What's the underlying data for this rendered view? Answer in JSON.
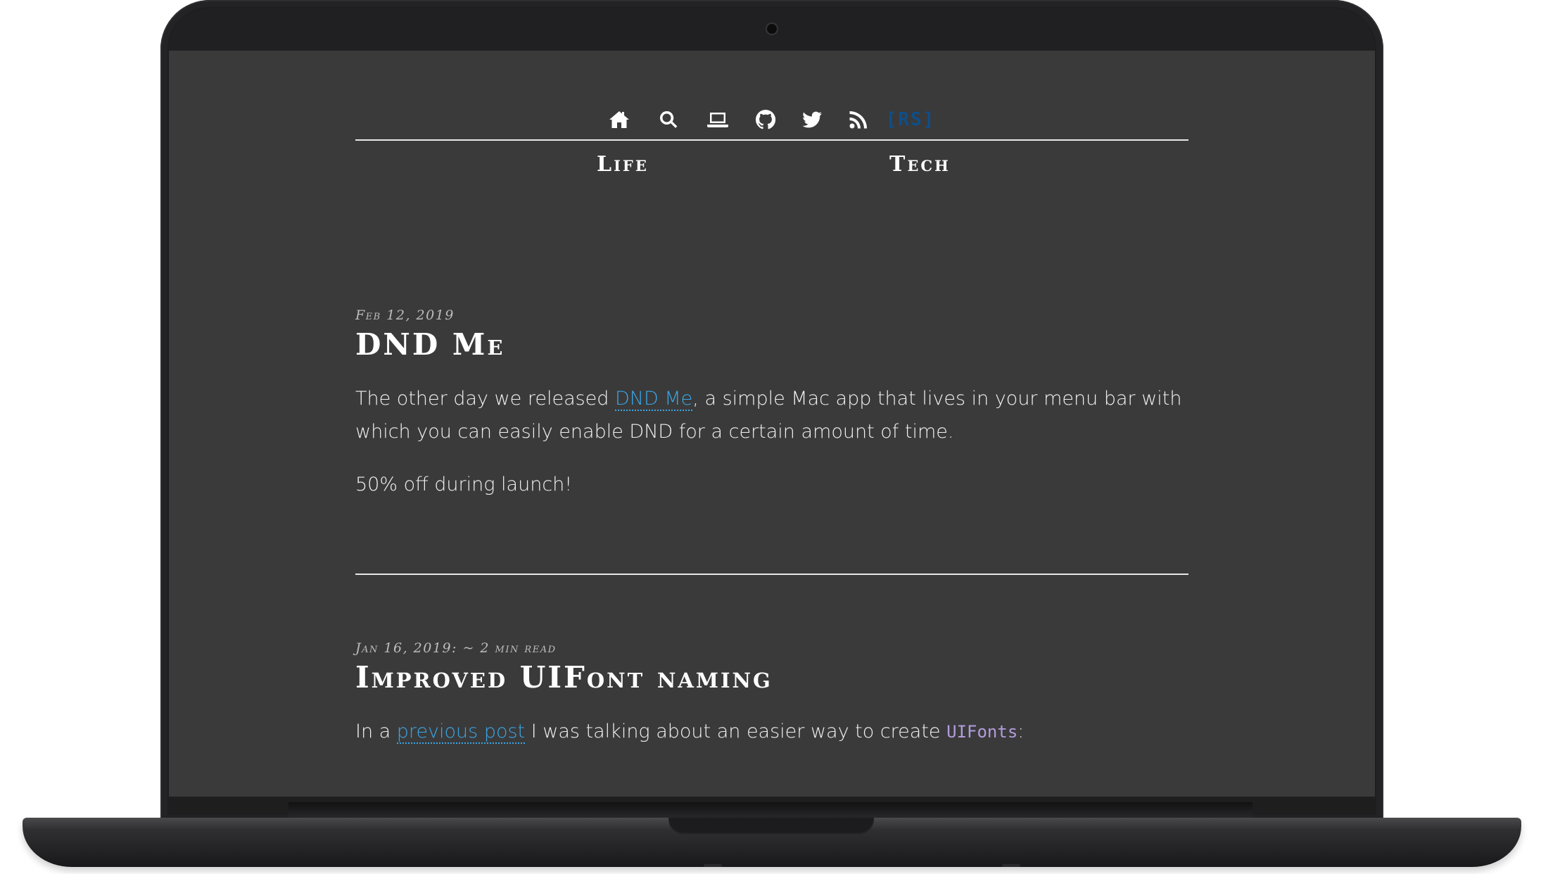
{
  "nav": {
    "icons": [
      {
        "name": "home-icon",
        "label": "Home"
      },
      {
        "name": "search-icon",
        "label": "Search"
      },
      {
        "name": "laptop-icon",
        "label": "Projects"
      },
      {
        "name": "github-icon",
        "label": "GitHub"
      },
      {
        "name": "twitter-icon",
        "label": "Twitter"
      },
      {
        "name": "rss-icon",
        "label": "RSS"
      }
    ],
    "logo_text": "[RS]",
    "logo_color": "#0d4f8a",
    "categories": [
      "Life",
      "Tech"
    ]
  },
  "posts": [
    {
      "meta": "Feb 12, 2019",
      "title": "DND Me",
      "body": {
        "p1_before": "The other day we released ",
        "p1_link": "DND Me",
        "p1_after": ", a simple Mac app that lives in your menu bar with which you can easily enable DND for a certain amount of time.",
        "p2": "50% off during launch!"
      }
    },
    {
      "meta": "Jan 16, 2019: ~ 2 min read",
      "title": "Improved UIFont naming",
      "body": {
        "p1_before": "In a ",
        "p1_link": "previous post",
        "p1_middle": " I was talking about an easier way to create ",
        "p1_code": "UIFonts",
        "p1_after": ":"
      }
    }
  ],
  "colors": {
    "page_background": "#3a3a3b",
    "link": "#3aa7e6",
    "code": "#b39ddb",
    "text": "#f2f2f2"
  }
}
